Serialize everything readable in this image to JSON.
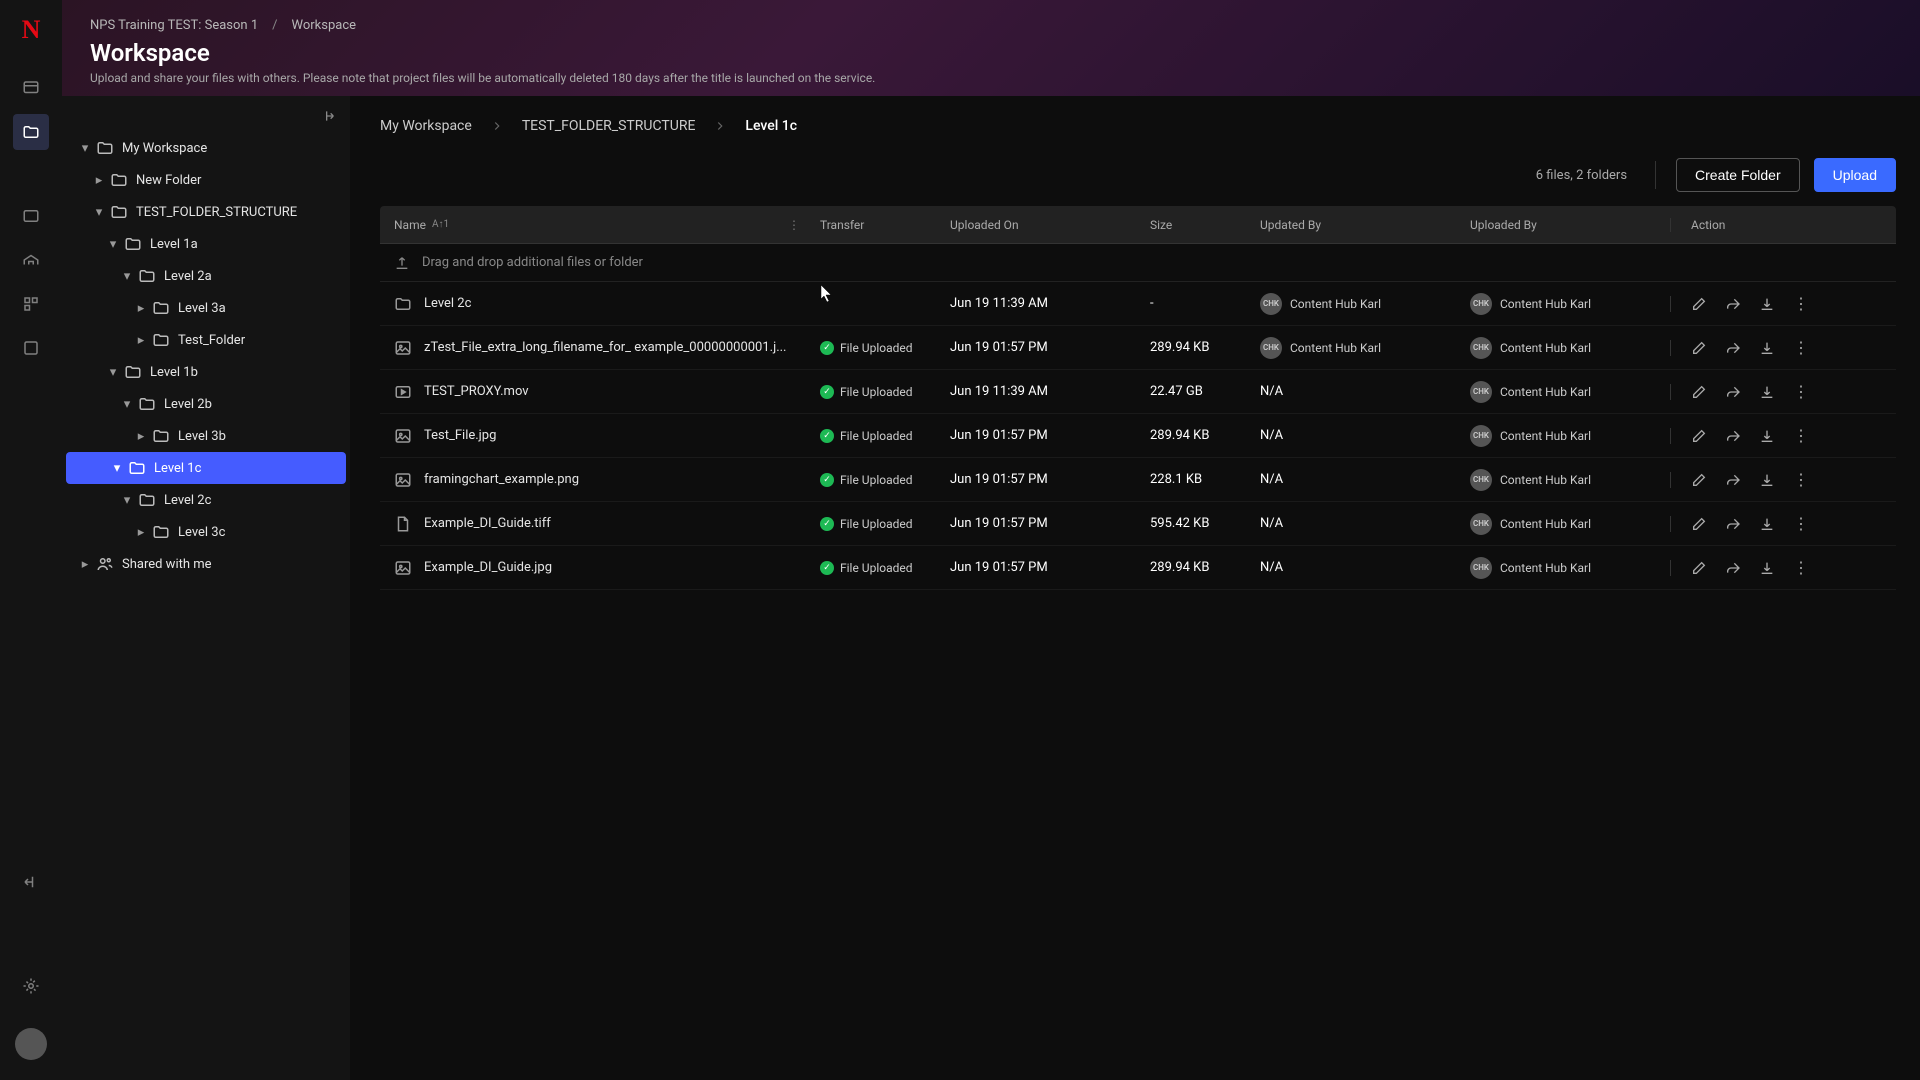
{
  "breadcrumb_top": {
    "project": "NPS Training TEST: Season 1",
    "section": "Workspace"
  },
  "page": {
    "title": "Workspace",
    "desc": "Upload and share your files with others. Please note that project files will be automatically deleted 180 days after the title is launched on the service."
  },
  "tree": {
    "my_workspace": "My Workspace",
    "new_folder": "New Folder",
    "test_folder": "TEST_FOLDER_STRUCTURE",
    "l1a": "Level 1a",
    "l2a": "Level 2a",
    "l3a": "Level 3a",
    "test_sub": "Test_Folder",
    "l1b": "Level 1b",
    "l2b": "Level 2b",
    "l3b": "Level 3b",
    "l1c": "Level 1c",
    "l2c": "Level 2c",
    "l3c": "Level 3c",
    "shared": "Shared with me"
  },
  "path": {
    "p0": "My Workspace",
    "p1": "TEST_FOLDER_STRUCTURE",
    "p2": "Level 1c"
  },
  "stats": "6 files, 2 folders",
  "buttons": {
    "create": "Create Folder",
    "upload": "Upload"
  },
  "columns": {
    "name": "Name",
    "transfer": "Transfer",
    "uploaded_on": "Uploaded On",
    "size": "Size",
    "updated_by": "Updated By",
    "uploaded_by": "Uploaded By",
    "action": "Action"
  },
  "sort_hint": "A↑1",
  "drop_hint": "Drag and drop additional files or folder",
  "transfer_label": "File Uploaded",
  "user": {
    "initials": "CHK",
    "name": "Content Hub Karl"
  },
  "rows": [
    {
      "name": "Level 2c",
      "icon": "folder",
      "transfer": "",
      "date": "Jun 19 11:39 AM",
      "size": "-",
      "updated": true,
      "uploaded": true
    },
    {
      "name": "zTest_File_extra_long_filename_for_ example_00000000001.j...",
      "icon": "image",
      "transfer": "uploaded",
      "date": "Jun 19 01:57 PM",
      "size": "289.94 KB",
      "updated": true,
      "uploaded": true
    },
    {
      "name": "TEST_PROXY.mov",
      "icon": "video",
      "transfer": "uploaded",
      "date": "Jun 19 11:39 AM",
      "size": "22.47 GB",
      "updated_na": "N/A",
      "uploaded": true
    },
    {
      "name": "Test_File.jpg",
      "icon": "image",
      "transfer": "uploaded",
      "date": "Jun 19 01:57 PM",
      "size": "289.94 KB",
      "updated_na": "N/A",
      "uploaded": true
    },
    {
      "name": "framingchart_example.png",
      "icon": "image",
      "transfer": "uploaded",
      "date": "Jun 19 01:57 PM",
      "size": "228.1 KB",
      "updated_na": "N/A",
      "uploaded": true
    },
    {
      "name": "Example_DI_Guide.tiff",
      "icon": "file",
      "transfer": "uploaded",
      "date": "Jun 19 01:57 PM",
      "size": "595.42 KB",
      "updated_na": "N/A",
      "uploaded": true
    },
    {
      "name": "Example_DI_Guide.jpg",
      "icon": "image",
      "transfer": "uploaded",
      "date": "Jun 19 01:57 PM",
      "size": "289.94 KB",
      "updated_na": "N/A",
      "uploaded": true
    }
  ]
}
